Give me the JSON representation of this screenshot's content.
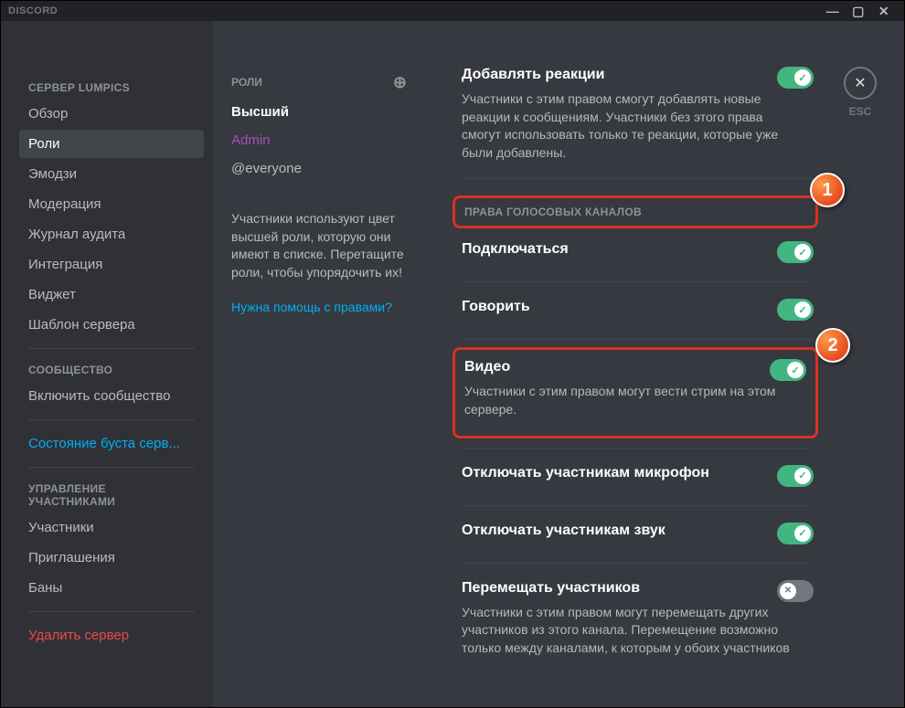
{
  "app_title": "DISCORD",
  "window_controls": {
    "min": "—",
    "max": "▢",
    "close": "✕"
  },
  "esc": {
    "symbol": "✕",
    "label": "ESC"
  },
  "sidebar": {
    "server_header": "СЕРВЕР LUMPICS",
    "items1": [
      "Обзор",
      "Роли",
      "Эмодзи",
      "Модерация",
      "Журнал аудита",
      "Интеграция",
      "Виджет",
      "Шаблон сервера"
    ],
    "community_header": "СООБЩЕСТВО",
    "items2": [
      "Включить сообщество"
    ],
    "boost": "Состояние буста серв...",
    "mgmt_header": "УПРАВЛЕНИЕ УЧАСТНИКАМИ",
    "items3": [
      "Участники",
      "Приглашения",
      "Баны"
    ],
    "delete": "Удалить сервер"
  },
  "roles": {
    "header": "РОЛИ",
    "list": [
      {
        "name": "Высший",
        "cls": "role-top"
      },
      {
        "name": "Admin",
        "cls": "role-admin"
      },
      {
        "name": "@everyone",
        "cls": "role-everyone"
      }
    ],
    "help_text": "Участники используют цвет высшей роли, которую они имеют в списке. Перетащите роли, чтобы упорядочить их!",
    "help_link": "Нужна помощь с правами?"
  },
  "perms": {
    "add_reactions": {
      "title": "Добавлять реакции",
      "desc": "Участники с этим правом смогут добавлять новые реакции к сообщениям. Участники без этого права смогут использовать только те реакции, которые уже были добавлены.",
      "on": true
    },
    "voice_section": "ПРАВА ГОЛОСОВЫХ КАНАЛОВ",
    "connect": {
      "title": "Подключаться",
      "on": true
    },
    "speak": {
      "title": "Говорить",
      "on": true
    },
    "video": {
      "title": "Видео",
      "desc": "Участники с этим правом могут вести стрим на этом сервере.",
      "on": true
    },
    "mute": {
      "title": "Отключать участникам микрофон",
      "on": true
    },
    "deafen": {
      "title": "Отключать участникам звук",
      "on": true
    },
    "move": {
      "title": "Перемещать участников",
      "desc": "Участники с этим правом могут перемещать других участников из этого канала. Перемещение возможно только между каналами, к которым у обоих участников",
      "on": false
    }
  },
  "badges": {
    "one": "1",
    "two": "2"
  }
}
